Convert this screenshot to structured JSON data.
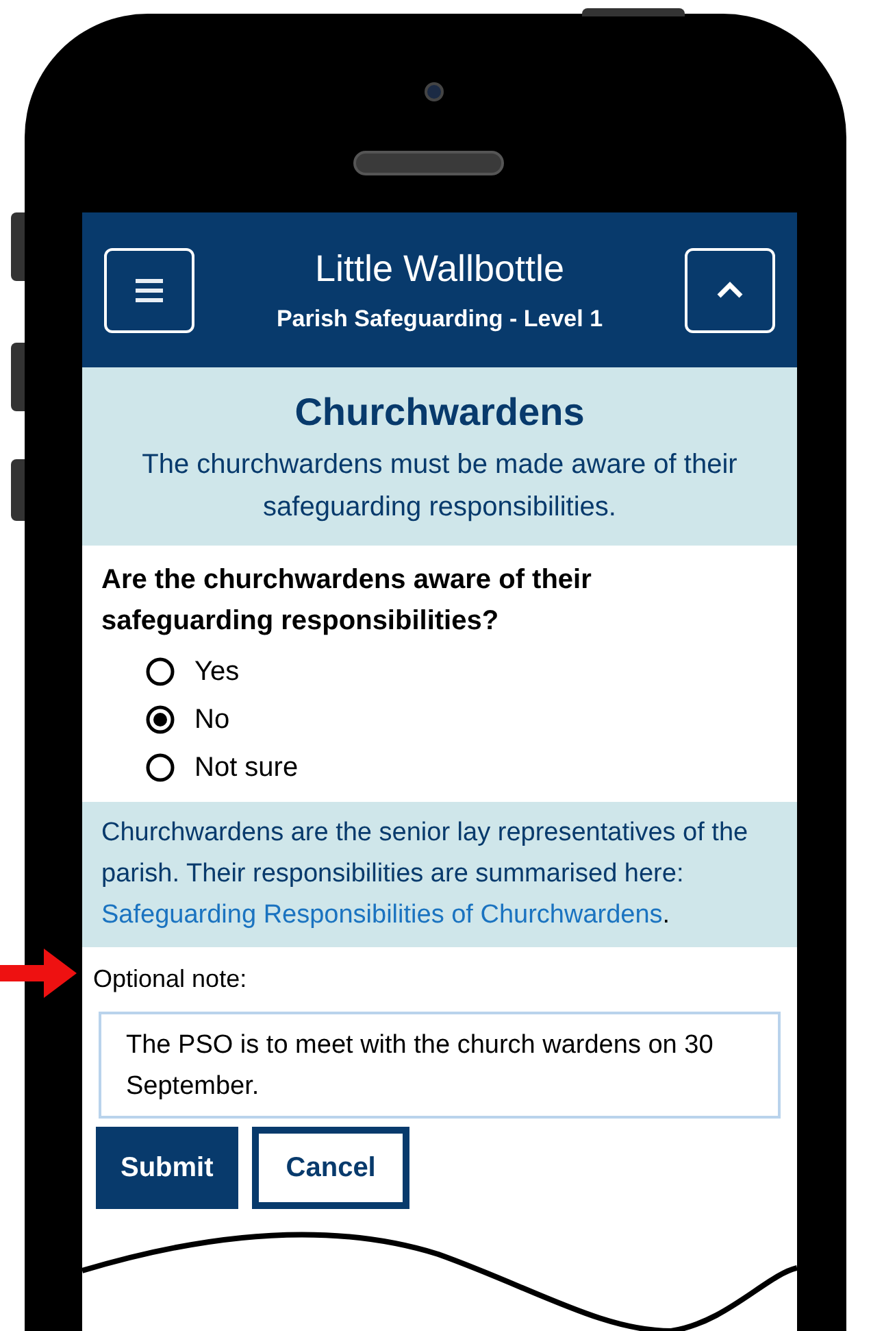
{
  "header": {
    "title": "Little Wallbottle",
    "subtitle": "Parish Safeguarding - Level 1"
  },
  "section": {
    "title": "Churchwardens",
    "description": "The churchwardens must be made aware of their safeguarding responsibilities."
  },
  "question": {
    "text": "Are the churchwardens aware of their safeguarding responsibilities?",
    "options": [
      {
        "label": "Yes",
        "selected": false
      },
      {
        "label": "No",
        "selected": true
      },
      {
        "label": "Not sure",
        "selected": false
      }
    ]
  },
  "info": {
    "text": "Churchwardens are the senior lay representatives of the parish.  Their responsibilities are summarised here: ",
    "link": "Safeguarding Responsibilities of Churchwardens",
    "after": "."
  },
  "note": {
    "label": "Optional note:",
    "value": "The PSO is to meet with the church wardens on 30 September."
  },
  "buttons": [
    {
      "label": "Submit",
      "kind": "primary"
    },
    {
      "label": "Cancel",
      "kind": "secondary"
    }
  ]
}
